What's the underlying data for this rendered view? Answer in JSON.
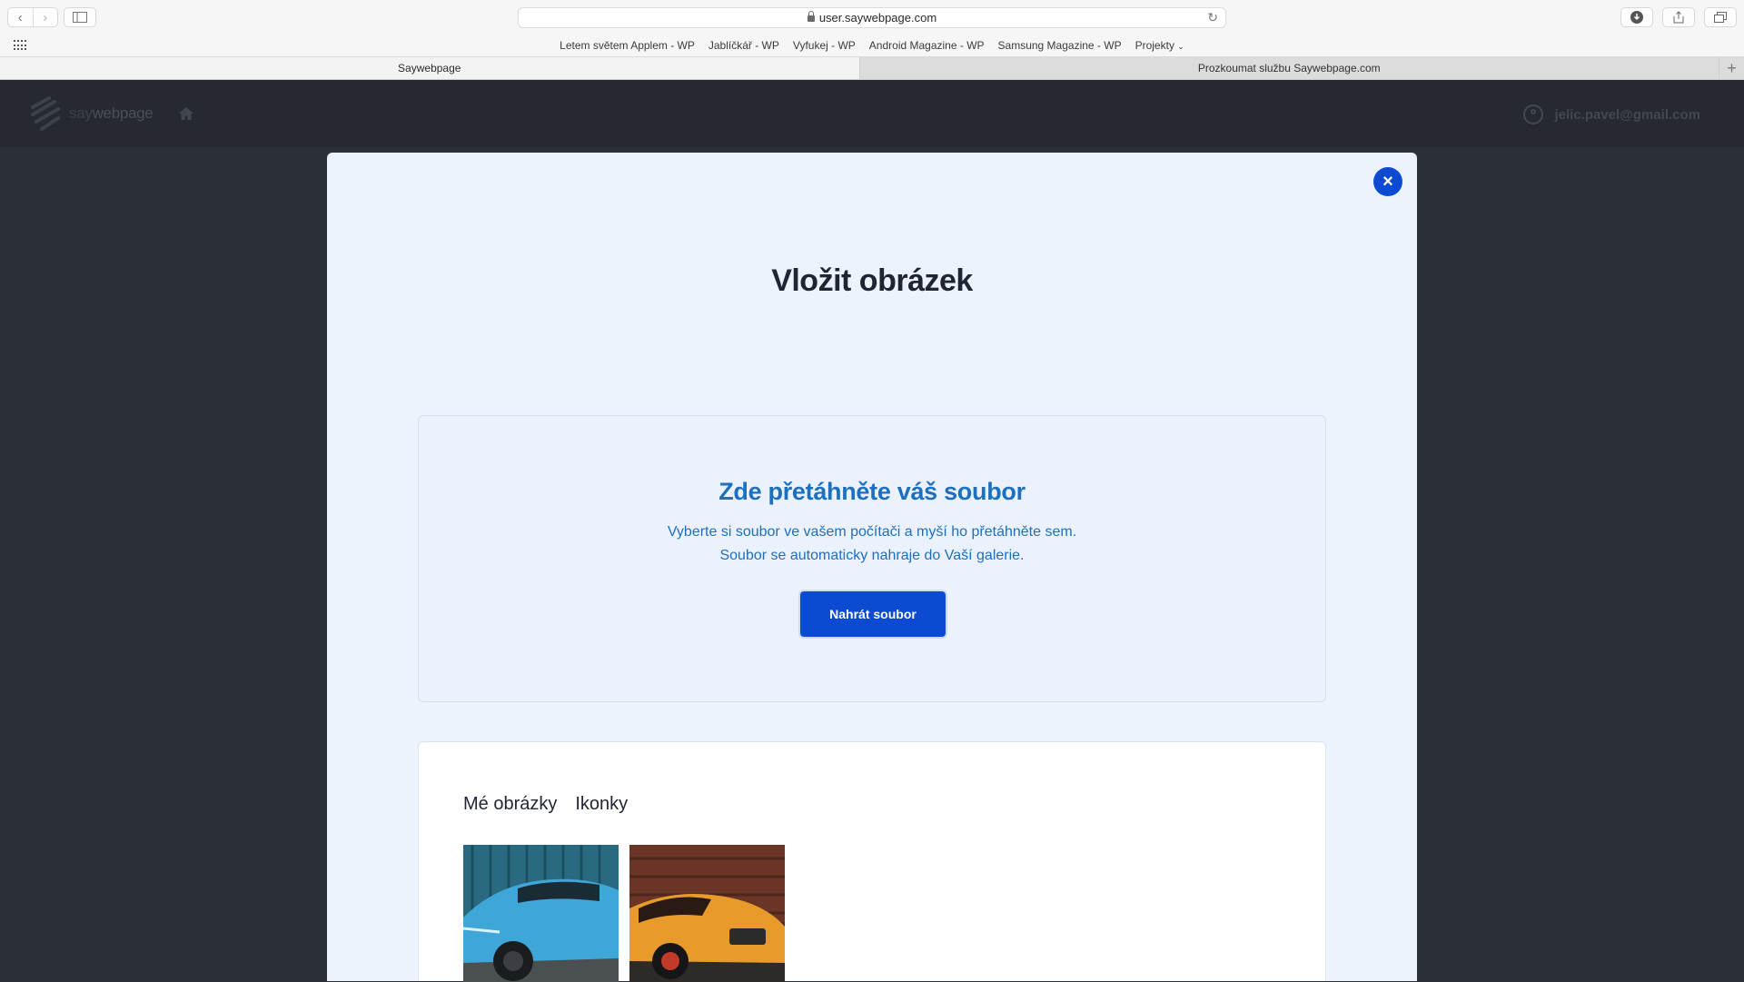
{
  "browser": {
    "url": "user.saywebpage.com",
    "bookmarks": [
      "Letem světem Applem - WP",
      "Jablíčkář - WP",
      "Vyfukej - WP",
      "Android Magazine - WP",
      "Samsung Magazine - WP",
      "Projekty"
    ],
    "tabs": [
      {
        "label": "Saywebpage",
        "active": true
      },
      {
        "label": "Prozkoumat službu Saywebpage.com",
        "active": false
      }
    ]
  },
  "app": {
    "logo_prefix": "say",
    "logo_suffix": "webpage",
    "user_email": "jelic.pavel@gmail.com"
  },
  "modal": {
    "title": "Vložit obrázek",
    "close_label": "×",
    "dropzone": {
      "title": "Zde přetáhněte váš soubor",
      "line1": "Vyberte si soubor ve vašem počítači a myší ho přetáhněte sem.",
      "line2": "Soubor se automaticky nahraje do Vaší galerie.",
      "upload_button": "Nahrát soubor"
    },
    "gallery": {
      "tabs": [
        "Mé obrázky",
        "Ikonky"
      ],
      "images": [
        {
          "description": "blue-car",
          "color": "#3fa6d8"
        },
        {
          "description": "orange-car",
          "color": "#e89a2a"
        }
      ]
    }
  },
  "colors": {
    "accent": "#0c4ad1",
    "dropzone_text": "#1d6fc0",
    "header_bg": "#26292f"
  }
}
